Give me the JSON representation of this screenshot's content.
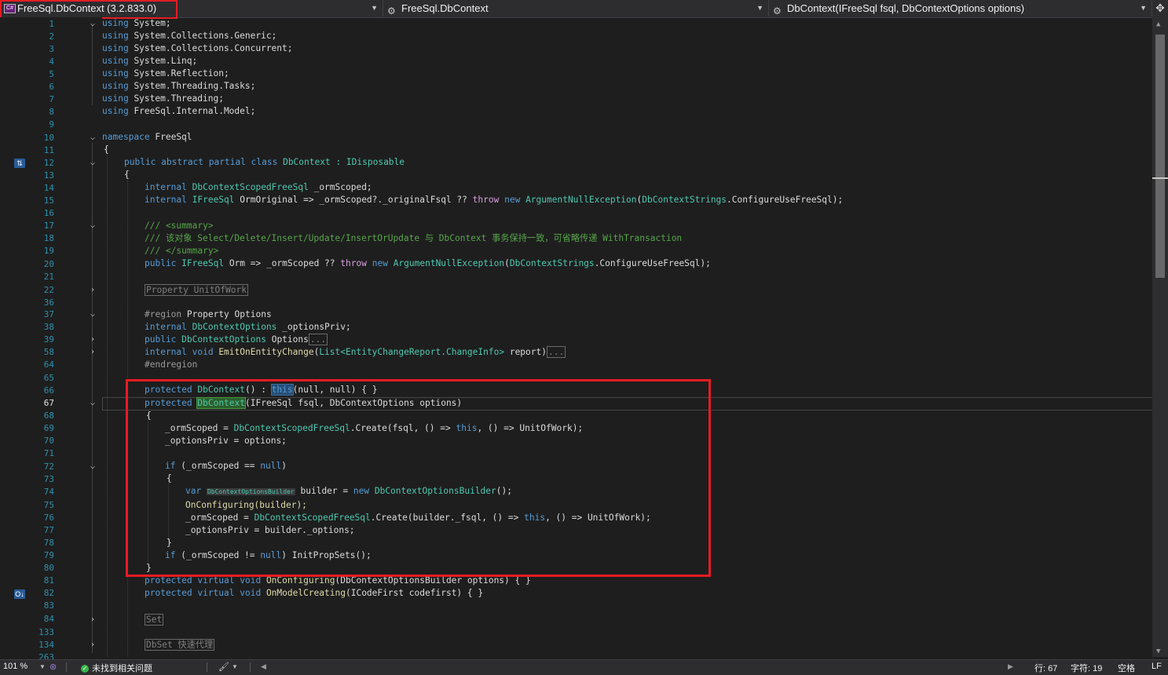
{
  "navbar": {
    "project": "FreeSql.DbContext (3.2.833.0)",
    "class": "FreeSql.DbContext",
    "member": "DbContext(IFreeSql fsql, DbContextOptions options)",
    "project_icon": "csharp-project-icon",
    "class_icon": "class-icon",
    "member_icon": "method-icon"
  },
  "line_numbers": [
    "1",
    "2",
    "3",
    "4",
    "5",
    "6",
    "7",
    "8",
    "9",
    "10",
    "11",
    "12",
    "13",
    "14",
    "15",
    "16",
    "17",
    "18",
    "19",
    "20",
    "21",
    "22",
    "36",
    "37",
    "38",
    "39",
    "58",
    "64",
    "65",
    "66",
    "67",
    "68",
    "69",
    "70",
    "71",
    "72",
    "73",
    "74",
    "75",
    "76",
    "77",
    "78",
    "79",
    "80",
    "81",
    "82",
    "83",
    "84",
    "133",
    "134",
    "263"
  ],
  "current_line": "67",
  "code": {
    "l1": "System;",
    "l2": "System.Collections.Generic;",
    "l3": "System.Collections.Concurrent;",
    "l4": "System.Linq;",
    "l5": "System.Reflection;",
    "l6": "System.Threading.Tasks;",
    "l7": "System.Threading;",
    "l8": "FreeSql.Internal.Model;",
    "using_kw": "using",
    "ns_kw": "namespace",
    "ns_name": "FreeSql",
    "class_mods": "public abstract partial class",
    "class_name": "DbContext",
    "class_base": ": IDisposable",
    "scoped_decl_kw": "internal",
    "scoped_decl_type": "DbContextScopedFreeSql",
    "scoped_decl_name": "_ormScoped;",
    "orig_kw": "internal",
    "orig_type": "IFreeSql",
    "orig_rest": "OrmOriginal => _ormScoped?._originalFsql ??",
    "throw_kw": "throw",
    "new_kw": "new",
    "argnull": "ArgumentNullException",
    "strings_cls": "DbContextStrings",
    "configure": ".ConfigureUseFreeSql);",
    "summary_open": "/// <summary>",
    "summary_text": "/// 该对象 Select/Delete/Insert/Update/InsertOrUpdate 与 DbContext 事务保持一致，可省略传递 WithTransaction",
    "summary_close": "/// </summary>",
    "orm_kw": "public",
    "orm_type": "IFreeSql",
    "orm_rest": "Orm => _ormScoped ??",
    "region_unitofwork": "Property UnitOfWork",
    "region_kw": "#region",
    "region_name": "Property Options",
    "opts_priv_kw": "internal",
    "opts_priv_type": "DbContextOptions",
    "opts_priv_name": "_optionsPriv;",
    "opts_kw": "public",
    "opts_type": "DbContextOptions",
    "opts_name": "Options",
    "ellipsis": "...",
    "emit_kw": "internal void",
    "emit_name": "EmitOnEntityChange",
    "emit_list": "List",
    "emit_generic": "<EntityChangeReport.ChangeInfo>",
    "emit_param": "report)",
    "endregion": "#endregion",
    "ctor1_kw": "protected",
    "ctor1_name": "DbContext",
    "ctor1_mid": "() :",
    "ctor1_this": "this",
    "ctor1_args": "(null, null) { }",
    "ctor2_kw": "protected",
    "ctor2_name": "DbContext",
    "ctor2_params": "(IFreeSql fsql, DbContextOptions options)",
    "brace_open": "{",
    "brace_close": "}",
    "l69_a": "_ormScoped =",
    "l69_cls": "DbContextScopedFreeSql",
    "l69_b": ".Create(fsql, () =>",
    "l69_this": "this",
    "l69_c": ", () => UnitOfWork);",
    "l70": "_optionsPriv = options;",
    "l72_kw": "if",
    "l72_rest": "(_ormScoped ==",
    "null_kw": "null",
    "paren_close": ")",
    "var_kw": "var",
    "var_type": "DbContextOptionsBuilder",
    "var_name": "builder =",
    "var_new": "new",
    "var_ctor": "DbContextOptionsBuilder",
    "var_end": "();",
    "onconf_call": "OnConfiguring(builder);",
    "l76_a": "_ormScoped =",
    "l76_b": ".Create(builder._fsql, () =>",
    "l76_c": ", () => UnitOfWork);",
    "l77": "_optionsPriv = builder._options;",
    "l79_kw": "if",
    "l79_a": "(_ormScoped !=",
    "l79_b": ") InitPropSets();",
    "l81_kw": "protected virtual void",
    "l81_name": "OnConfiguring",
    "l81_params": "(DbContextOptionsBuilder options) { }",
    "l82_kw": "protected virtual void",
    "l82_name": "OnModelCreating",
    "l82_params": "(ICodeFirst codefirst) { }",
    "region_set": "Set",
    "region_dbset": "DbSet 快速代理"
  },
  "status_bar": {
    "zoom": "101 %",
    "issues": "未找到相关问题",
    "line": "行: 67",
    "char": "字符: 19",
    "spaces": "空格",
    "eol": "LF"
  },
  "colors": {
    "background": "#1e1e1e",
    "keyword": "#569cd6",
    "type": "#4ec9b0",
    "comment": "#57a64a",
    "line_number": "#2b91af",
    "highlight_box": "#e51c23"
  }
}
